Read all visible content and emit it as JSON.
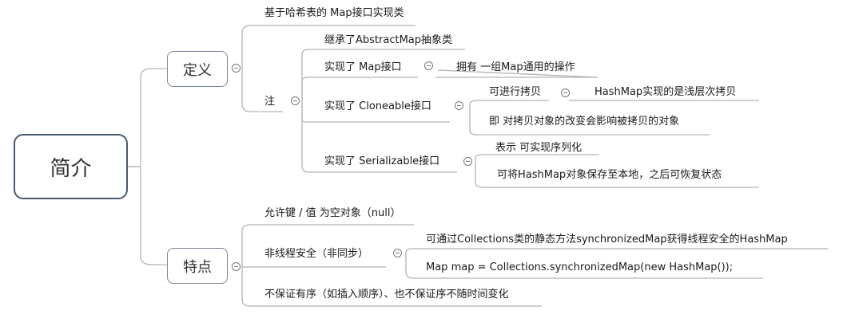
{
  "root": "简介",
  "definition": {
    "label": "定义",
    "basic": "基于哈希表的 Map接口实现类",
    "note": {
      "label": "注",
      "inherits": "继承了AbstractMap抽象类",
      "map_iface": {
        "label": "实现了 Map接口",
        "detail": "拥有 一组Map通用的操作"
      },
      "cloneable": {
        "label": "实现了 Cloneable接口",
        "can_copy": "可进行拷贝",
        "shallow": "HashMap实现的是浅层次拷贝",
        "meaning": "即 对拷贝对象的改变会影响被拷贝的对象"
      },
      "serializable": {
        "label": "实现了 Serializable接口",
        "means": "表示 可实现序列化",
        "save": "可将HashMap对象保存至本地，之后可恢复状态"
      }
    }
  },
  "features": {
    "label": "特点",
    "nulls": "允许键 / 值 为空对象（null）",
    "thread": {
      "label": "非线程安全（非同步）",
      "via": "可通过Collections类的静态方法synchronizedMap获得线程安全的HashMap",
      "code": "Map map = Collections.synchronizedMap(new HashMap());"
    },
    "order": "不保证有序（如插入顺序）、也不保证序不随时间变化"
  },
  "colors": {
    "line": "#b4b4b4",
    "root_border": "#4a5a70",
    "node_border": "#7a8796"
  }
}
